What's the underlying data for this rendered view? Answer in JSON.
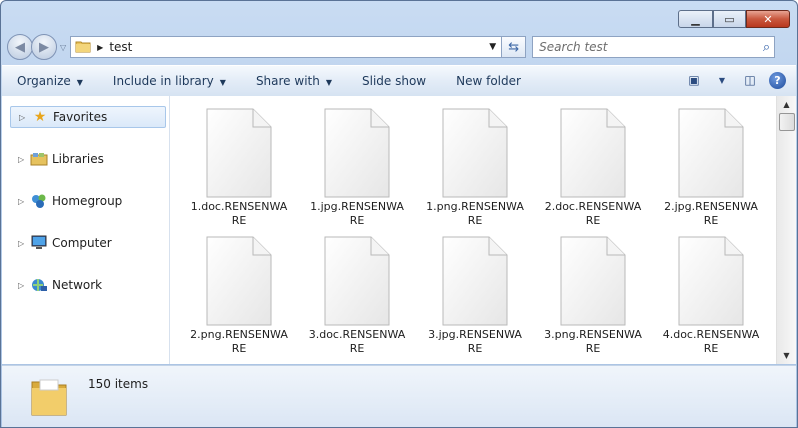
{
  "address": {
    "path": "test"
  },
  "search": {
    "placeholder": "Search test"
  },
  "toolbar": {
    "organize": "Organize",
    "include": "Include in library",
    "share": "Share with",
    "slideshow": "Slide show",
    "newfolder": "New folder"
  },
  "sidebar": {
    "items": [
      {
        "label": "Favorites",
        "icon": "star-icon"
      },
      {
        "label": "Libraries",
        "icon": "libraries-icon"
      },
      {
        "label": "Homegroup",
        "icon": "homegroup-icon"
      },
      {
        "label": "Computer",
        "icon": "computer-icon"
      },
      {
        "label": "Network",
        "icon": "network-icon"
      }
    ]
  },
  "files": [
    "1.doc.RENSENWARE",
    "1.jpg.RENSENWARE",
    "1.png.RENSENWARE",
    "2.doc.RENSENWARE",
    "2.jpg.RENSENWARE",
    "2.png.RENSENWARE",
    "3.doc.RENSENWARE",
    "3.jpg.RENSENWARE",
    "3.png.RENSENWARE",
    "4.doc.RENSENWARE"
  ],
  "details": {
    "count": "150 items"
  },
  "colors": {
    "accent": "#3c67a6",
    "close": "#c9583e"
  }
}
